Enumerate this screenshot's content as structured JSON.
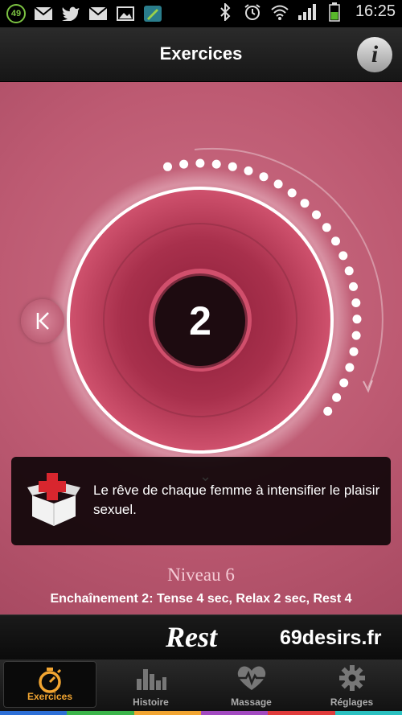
{
  "status_bar": {
    "notification_count": "49",
    "icons": [
      "gmail-icon",
      "twitter-icon",
      "gmail-icon",
      "image-icon",
      "app-icon"
    ],
    "right_icons": [
      "bluetooth-icon",
      "alarm-icon",
      "wifi-icon",
      "signal-icon",
      "battery-icon"
    ],
    "time": "16:25"
  },
  "header": {
    "title": "Exercices",
    "info_label": "i"
  },
  "main": {
    "counter": "2",
    "toast_text": "Le rêve de chaque femme à intensifier le plaisir sexuel.",
    "level": "Niveau 6",
    "sequence": "Enchaînement 2: Tense 4 sec, Relax 2 sec, Rest 4",
    "progress_dots": 24
  },
  "rest_bar": {
    "phase": "Rest",
    "watermark": "69desirs.fr"
  },
  "tabs": [
    {
      "label": "Exercices",
      "icon": "stopwatch-icon",
      "active": true
    },
    {
      "label": "Histoire",
      "icon": "bar-chart-icon",
      "active": false
    },
    {
      "label": "Massage",
      "icon": "heart-pulse-icon",
      "active": false
    },
    {
      "label": "Réglages",
      "icon": "gear-icon",
      "active": false
    }
  ],
  "colors": {
    "accent": "#f2a531",
    "background_pink": "#bd5a72",
    "stripe": [
      "#2d6fd6",
      "#3bb54a",
      "#f2a531",
      "#a24ac0",
      "#e03c3c",
      "#2bc0c0"
    ]
  }
}
